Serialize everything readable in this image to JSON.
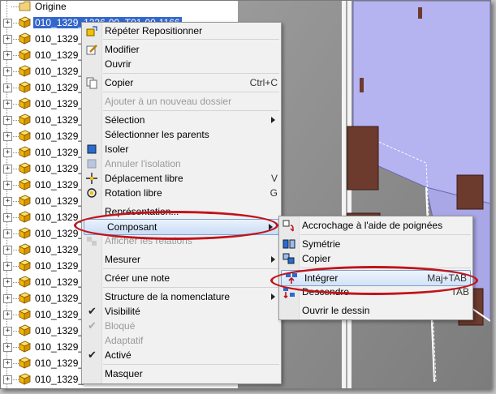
{
  "tree": {
    "origin_label": "Origine",
    "selected_label": "010_1329_1236-00_T01-00-1166",
    "item_label": "010_1329_"
  },
  "context_menu": {
    "items": [
      {
        "label": "Répéter Repositionner"
      },
      {
        "label": "Modifier"
      },
      {
        "label": "Ouvrir"
      },
      {
        "label": "Copier",
        "shortcut": "Ctrl+C"
      },
      {
        "label": "Ajouter à un nouveau dossier"
      },
      {
        "label": "Sélection"
      },
      {
        "label": "Sélectionner les parents"
      },
      {
        "label": "Isoler"
      },
      {
        "label": "Annuler l'isolation"
      },
      {
        "label": "Déplacement libre",
        "shortcut": "V"
      },
      {
        "label": "Rotation libre",
        "shortcut": "G"
      },
      {
        "label": "Représentation..."
      },
      {
        "label": "Composant"
      },
      {
        "label": "Afficher les relations"
      },
      {
        "label": "Mesurer"
      },
      {
        "label": "Créer une note"
      },
      {
        "label": "Structure de la nomenclature"
      },
      {
        "label": "Visibilité"
      },
      {
        "label": "Bloqué"
      },
      {
        "label": "Adaptatif"
      },
      {
        "label": "Activé"
      },
      {
        "label": "Masquer"
      }
    ]
  },
  "submenu": {
    "items": [
      {
        "label": "Accrochage à l'aide de poignées"
      },
      {
        "label": "Symétrie"
      },
      {
        "label": "Copier"
      },
      {
        "label": "Intégrer",
        "shortcut": "Maj+TAB"
      },
      {
        "label": "Descendre",
        "shortcut": "TAB"
      },
      {
        "label": "Ouvrir le dessin"
      }
    ]
  },
  "colors": {
    "highlight_ring": "#c0141b",
    "selection": "#3366cc",
    "panel": "#b5b3f0"
  }
}
